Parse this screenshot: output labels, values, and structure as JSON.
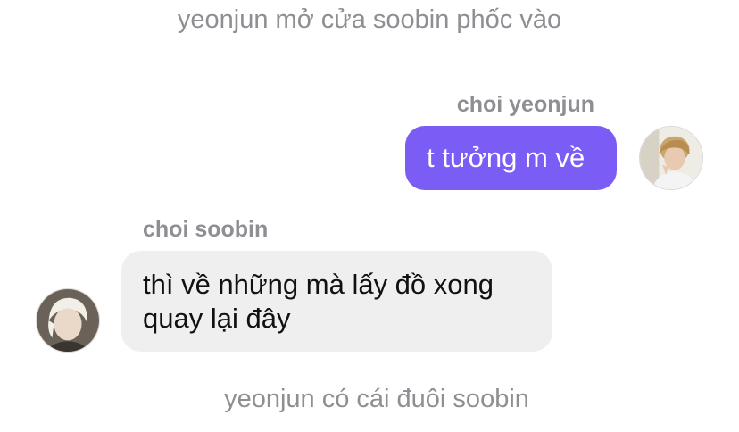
{
  "system_messages": {
    "top": "yeonjun mở cửa soobin phốc vào",
    "bottom": "yeonjun có cái đuôi soobin"
  },
  "messages": [
    {
      "direction": "outgoing",
      "sender": "choi yeonjun",
      "text": "t tưởng m về",
      "bubble_color": "#7b5cf5"
    },
    {
      "direction": "incoming",
      "sender": "choi soobin",
      "text_line1": "thì về những mà lấy đồ xong",
      "text_line2": "quay lại đây",
      "bubble_color": "#efefef"
    }
  ],
  "avatars": {
    "outgoing": "profile-photo",
    "incoming": "profile-photo"
  }
}
